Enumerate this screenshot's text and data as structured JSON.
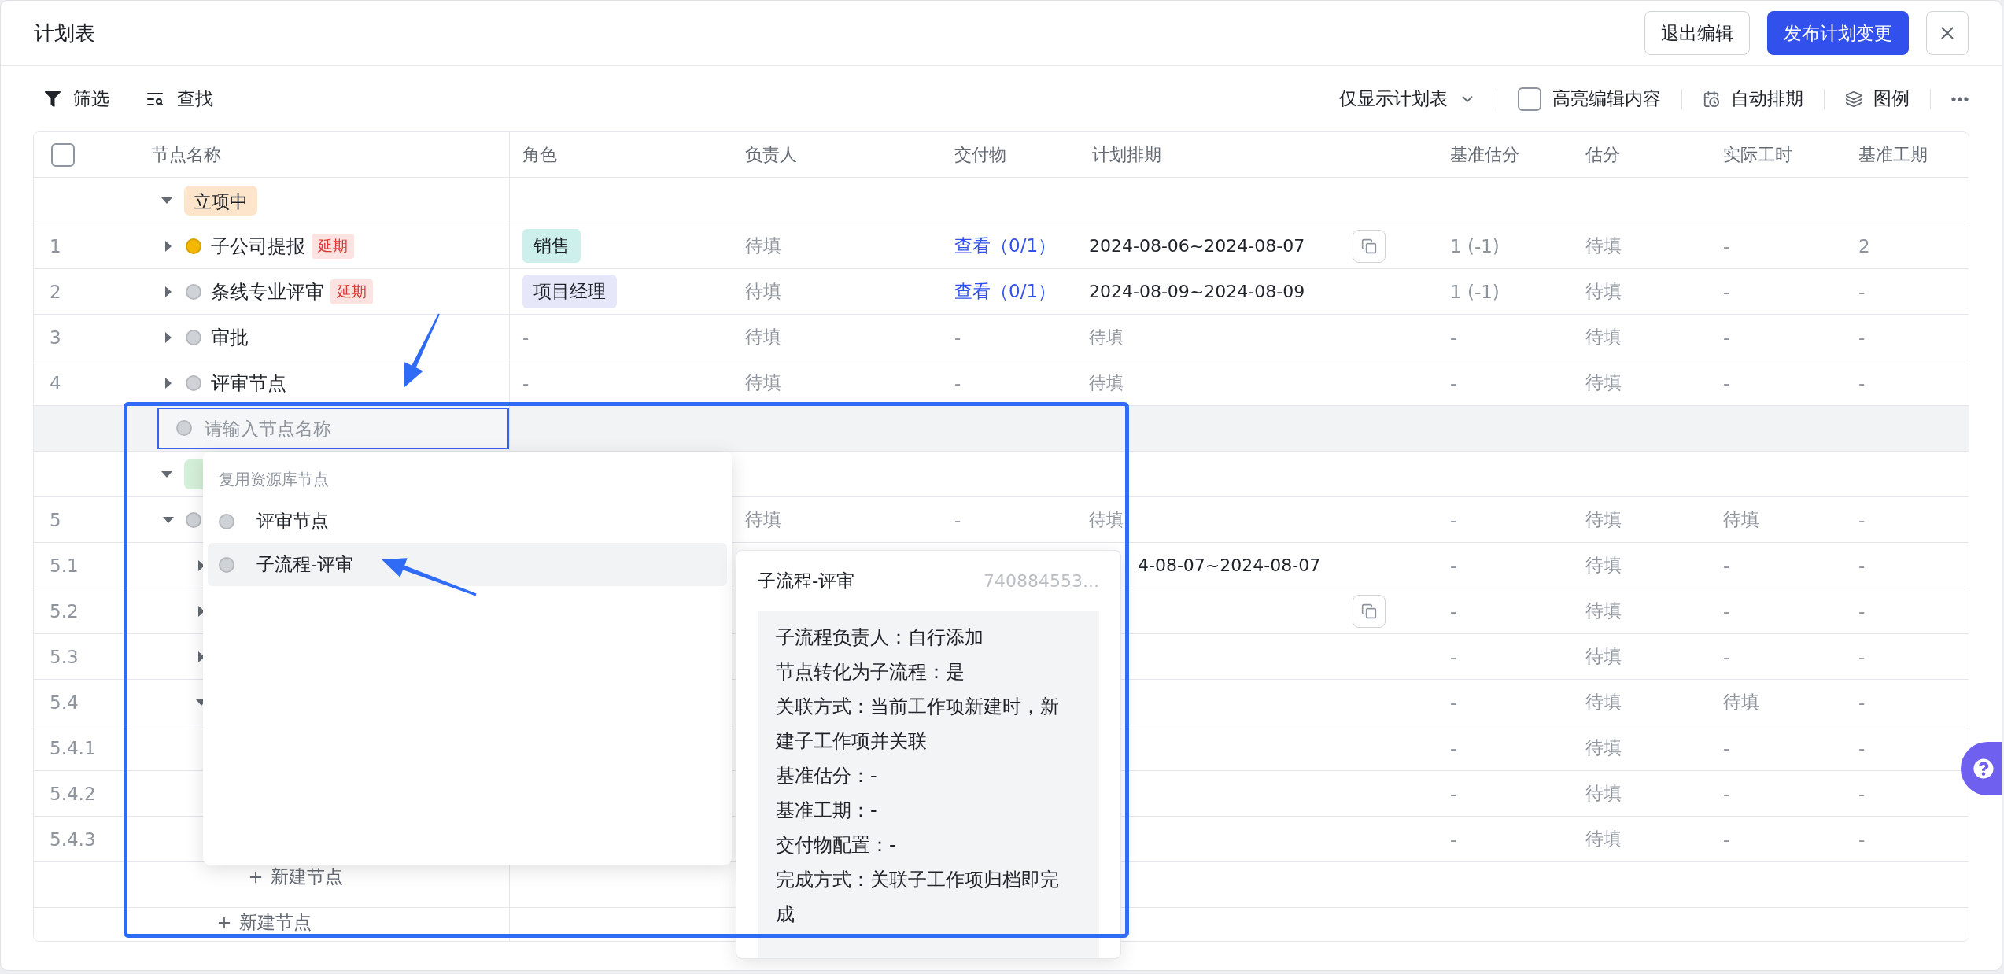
{
  "window": {
    "title": "计划表"
  },
  "header_buttons": [
    {
      "label": "退出编辑",
      "kind": "secondary"
    },
    {
      "label": "发布计划变更",
      "kind": "primary"
    }
  ],
  "toolbar": {
    "left": [
      {
        "label": "筛选"
      },
      {
        "label": "查找"
      }
    ],
    "view": "仅显示计划表",
    "highlight": {
      "label": "高亮编辑内容",
      "checked": false
    },
    "auto": "自动排期",
    "legend": "图例"
  },
  "table": {
    "select_all_checked": false,
    "columns": [
      "节点名称",
      "角色",
      "负责人",
      "交付物",
      "计划排期",
      "基准估分",
      "估分",
      "实际工时",
      "基准工期"
    ],
    "groups": [
      {
        "kind": "group",
        "tag": "立项中",
        "color": "#fde5cc",
        "expanded": true,
        "children": [
          {
            "kind": "node",
            "index": "1",
            "expanded": false,
            "color": "#f5b800",
            "name": "子公司提报",
            "badge": "延期",
            "role": {
              "label": "销售",
              "color": "#cdf0ec"
            },
            "owner": "待填",
            "deliverable": {
              "text": "查看（0/1）",
              "link": true
            },
            "plan": {
              "text": "2024-08-06~2024-08-07",
              "filled": true
            },
            "linked": true,
            "base_est": "1 (-1)",
            "est": "待填",
            "actual": "-",
            "base_period": "2"
          },
          {
            "kind": "node",
            "index": "2",
            "expanded": false,
            "color": "#cfd2d7",
            "name": "条线专业评审",
            "badge": "延期",
            "role": {
              "label": "项目经理",
              "color": "#e6e8fa"
            },
            "owner": "待填",
            "deliverable": {
              "text": "查看（0/1）",
              "link": true
            },
            "plan": {
              "text": "2024-08-09~2024-08-09",
              "filled": true
            },
            "linked": false,
            "base_est": "1 (-1)",
            "est": "待填",
            "actual": "-",
            "base_period": "-"
          },
          {
            "kind": "node",
            "index": "3",
            "expanded": false,
            "color": "#cfd2d7",
            "name": "审批",
            "role": {
              "label": "-"
            },
            "owner": "待填",
            "deliverable": {
              "text": "-",
              "link": false
            },
            "plan": {
              "text": "待填",
              "filled": false
            },
            "linked": false,
            "base_est": "-",
            "est": "待填",
            "actual": "-",
            "base_period": "-"
          },
          {
            "kind": "node",
            "index": "4",
            "expanded": false,
            "color": "#cfd2d7",
            "name": "评审节点",
            "role": {
              "label": "-"
            },
            "owner": "待填",
            "deliverable": {
              "text": "-",
              "link": false
            },
            "plan": {
              "text": "待填",
              "filled": false
            },
            "linked": false,
            "base_est": "-",
            "est": "待填",
            "actual": "-",
            "base_period": "-"
          },
          {
            "kind": "input",
            "placeholder": "请输入节点名称",
            "color": "#cfd2d7"
          }
        ]
      },
      {
        "kind": "group",
        "color": "#d5f0d8",
        "expanded": true,
        "children": [
          {
            "kind": "node",
            "index": "5",
            "expanded": true,
            "color": "#cfd2d7",
            "owner": "待填",
            "deliverable": {
              "text": "-",
              "link": false
            },
            "plan": {
              "text": "待填",
              "filled": false
            },
            "linked": false,
            "base_est": "-",
            "est": "待填",
            "actual": "待填",
            "base_period": "-",
            "children": [
              {
                "kind": "covered",
                "index": "5.1",
                "expanded": false,
                "plan": {
                  "text": "4-08-07~2024-08-07",
                  "filled": true
                },
                "linked": false,
                "base_est": "-",
                "est": "待填",
                "actual": "-",
                "base_period": "-"
              },
              {
                "kind": "covered",
                "index": "5.2",
                "expanded": false,
                "linked": true,
                "base_est": "-",
                "est": "待填",
                "actual": "-",
                "base_period": "-"
              },
              {
                "kind": "covered",
                "index": "5.3",
                "expanded": false,
                "linked": false,
                "base_est": "-",
                "est": "待填",
                "actual": "-",
                "base_period": "-"
              },
              {
                "kind": "covered",
                "index": "5.4",
                "expanded": true,
                "linked": false,
                "base_est": "-",
                "est": "待填",
                "actual": "待填",
                "base_period": "-",
                "children": [
                  {
                    "kind": "covered",
                    "index": "5.4.1",
                    "linked": false,
                    "base_est": "-",
                    "est": "待填",
                    "actual": "-",
                    "base_period": "-"
                  },
                  {
                    "kind": "covered",
                    "index": "5.4.2",
                    "linked": false,
                    "base_est": "-",
                    "est": "待填",
                    "actual": "-",
                    "base_period": "-"
                  },
                  {
                    "kind": "covered",
                    "index": "5.4.3",
                    "linked": false,
                    "base_est": "-",
                    "est": "待填",
                    "actual": "-",
                    "base_period": "-"
                  }
                ]
              },
              {
                "kind": "add",
                "label": "新建节点"
              }
            ]
          },
          {
            "kind": "add",
            "label": "新建节点"
          }
        ]
      }
    ]
  },
  "dropdown": {
    "header": "复用资源库节点",
    "items": [
      {
        "label": "评审节点",
        "selected": false
      },
      {
        "label": "子流程-评审",
        "selected": true
      }
    ]
  },
  "tooltip": {
    "title": "子流程-评审",
    "code": "740884553...",
    "lines": [
      "子流程负责人：自行添加",
      "节点转化为子流程：是",
      "关联方式：当前工作项新建时，新建子工作项并关联",
      "基准估分：-",
      "基准工期：-",
      "交付物配置：-",
      "完成方式：关联子工作项归档即完成"
    ]
  }
}
